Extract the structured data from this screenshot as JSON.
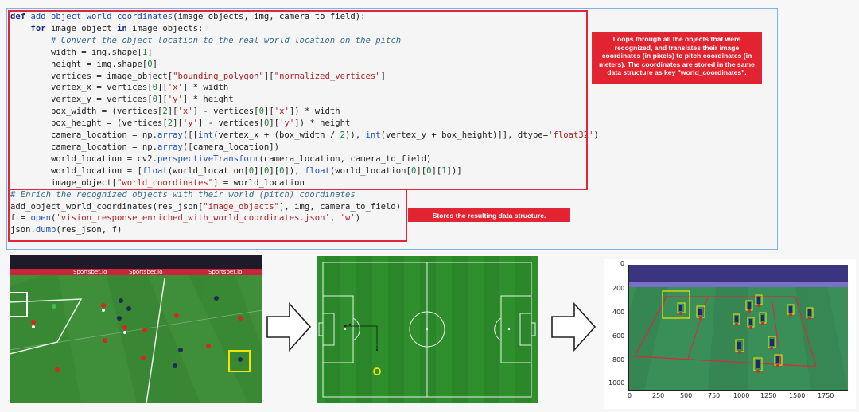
{
  "code_lines": [
    "def add_object_world_coordinates(image_objects, img, camera_to_field):",
    "    for image_object in image_objects:",
    "        # Convert the object location to the real world location on the pitch",
    "        width = img.shape[1]",
    "        height = img.shape[0]",
    "        vertices = image_object[\"bounding_polygon\"][\"normalized_vertices\"]",
    "        vertex_x = vertices[0]['x'] * width",
    "        vertex_y = vertices[0]['y'] * height",
    "        box_width = (vertices[2]['x'] - vertices[0]['x']) * width",
    "        box_height = (vertices[2]['y'] - vertices[0]['y']) * height",
    "        camera_location = np.array([[int(vertex_x + (box_width / 2)), int(vertex_y + box_height)]], dtype='float32')",
    "        camera_location = np.array([camera_location])",
    "        world_location = cv2.perspectiveTransform(camera_location, camera_to_field)",
    "        world_location = [float(world_location[0][0][0]), float(world_location[0][0][1])]",
    "        image_object[\"world_coordinates\"] = world_location",
    "# Enrich the recognized objects with their world (pitch) coordinates",
    "add_object_world_coordinates(res_json[\"image_objects\"], img, camera_to_field)",
    "f = open('vision_response_enriched_with_world_coordinates.json', 'w')",
    "json.dump(res_json, f)"
  ],
  "notes": {
    "function_note": "Loops through all the objects that were recognized, and translates their image coordinates (in pixels) to pitch coordinates (in meters). The coordinates are stored in the same data structure as key \"world_coordinates\".",
    "store_note": "Stores the resulting data structure."
  },
  "broadcast_image": {
    "ad_text": "Sportsbet.io"
  },
  "plot_axes": {
    "y_ticks": [
      "0",
      "200",
      "400",
      "600",
      "800",
      "1000"
    ],
    "x_ticks": [
      "0",
      "250",
      "500",
      "750",
      "1000",
      "1250",
      "1500",
      "1750"
    ]
  },
  "colors": {
    "highlight_red": "#e0263a",
    "pitch_green": "#2f8f2c",
    "detection_yellow": "#f2e600"
  }
}
